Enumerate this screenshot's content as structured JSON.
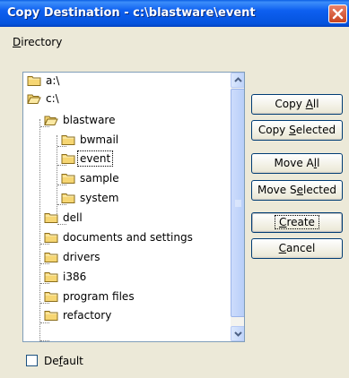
{
  "window": {
    "title": "Copy Destination - c:\\blastware\\event"
  },
  "directory_label": {
    "accel": "D",
    "rest": "irectory"
  },
  "tree": {
    "items": [
      {
        "label": "a:\\",
        "open": false
      },
      {
        "label": "c:\\",
        "open": true
      },
      {
        "label": "blastware",
        "open": true
      },
      {
        "label": "bwmail",
        "open": false
      },
      {
        "label": "event",
        "open": false,
        "focused": true
      },
      {
        "label": "sample",
        "open": false
      },
      {
        "label": "system",
        "open": false
      },
      {
        "label": "dell",
        "open": false
      },
      {
        "label": "documents and settings",
        "open": false
      },
      {
        "label": "drivers",
        "open": false
      },
      {
        "label": "i386",
        "open": false
      },
      {
        "label": "program files",
        "open": false
      },
      {
        "label": "refactory",
        "open": false
      }
    ]
  },
  "buttons": {
    "copy_all": {
      "pre": "Copy ",
      "accel": "A",
      "post": "ll"
    },
    "copy_selected": {
      "pre": "Copy ",
      "accel": "S",
      "post": "elected"
    },
    "move_all": {
      "pre": "Move A",
      "accel": "l",
      "post": "l"
    },
    "move_selected": {
      "pre": "Move S",
      "accel": "e",
      "post": "lected"
    },
    "create": {
      "pre": "",
      "accel": "C",
      "post": "reate"
    },
    "cancel": {
      "pre": "",
      "accel": "C",
      "post": "ancel"
    }
  },
  "default_checkbox": {
    "pre": "De",
    "accel": "f",
    "post": "ault",
    "checked": false
  },
  "colors": {
    "title_bar": "#0a5fe3",
    "dialog_bg": "#ece9d8",
    "close_button": "#c8431f",
    "folder": "#f6d673"
  }
}
